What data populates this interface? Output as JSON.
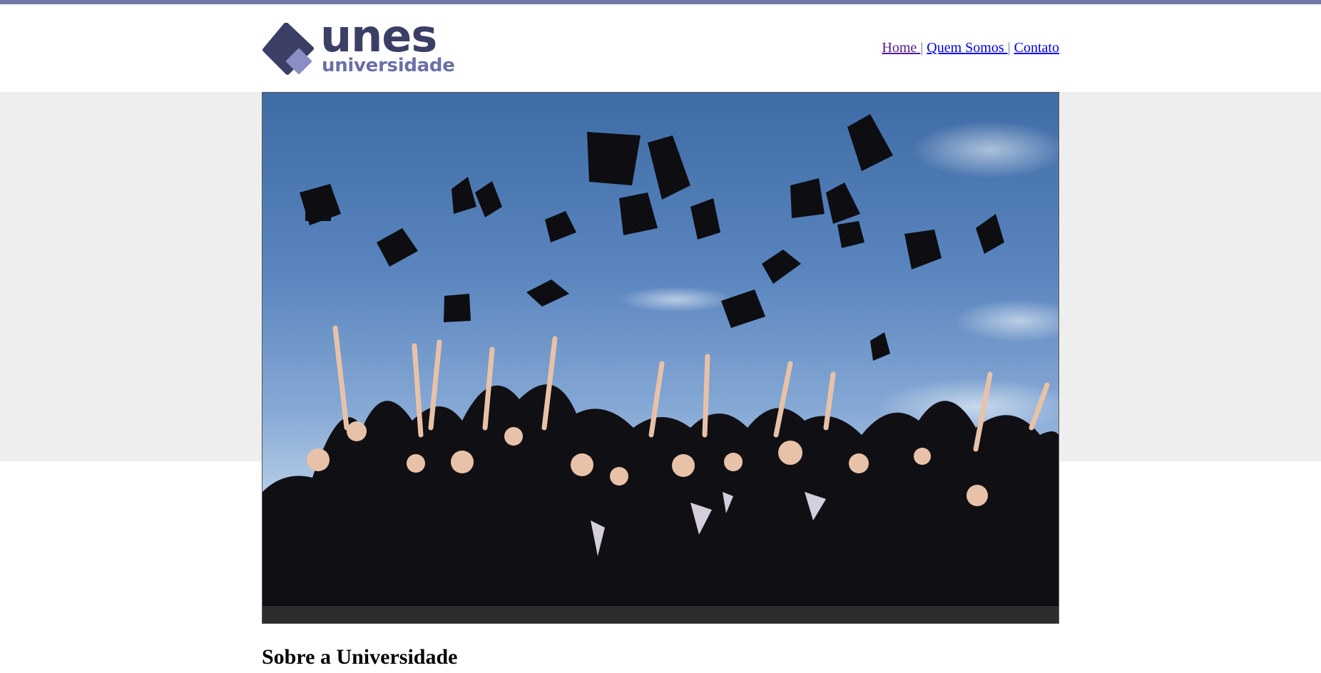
{
  "brand": {
    "name": "unes",
    "tagline": "universidade",
    "colors": {
      "primary": "#3b3f66",
      "accent": "#6b70a8",
      "stripe": "#7478a8"
    }
  },
  "nav": {
    "items": [
      {
        "label": "Home "
      },
      {
        "label": "Quem Somos "
      },
      {
        "label": "Contato"
      }
    ],
    "separator": "|"
  },
  "hero": {
    "image": "graduation-caps-photo"
  },
  "content": {
    "heading": "Sobre a Universidade"
  }
}
